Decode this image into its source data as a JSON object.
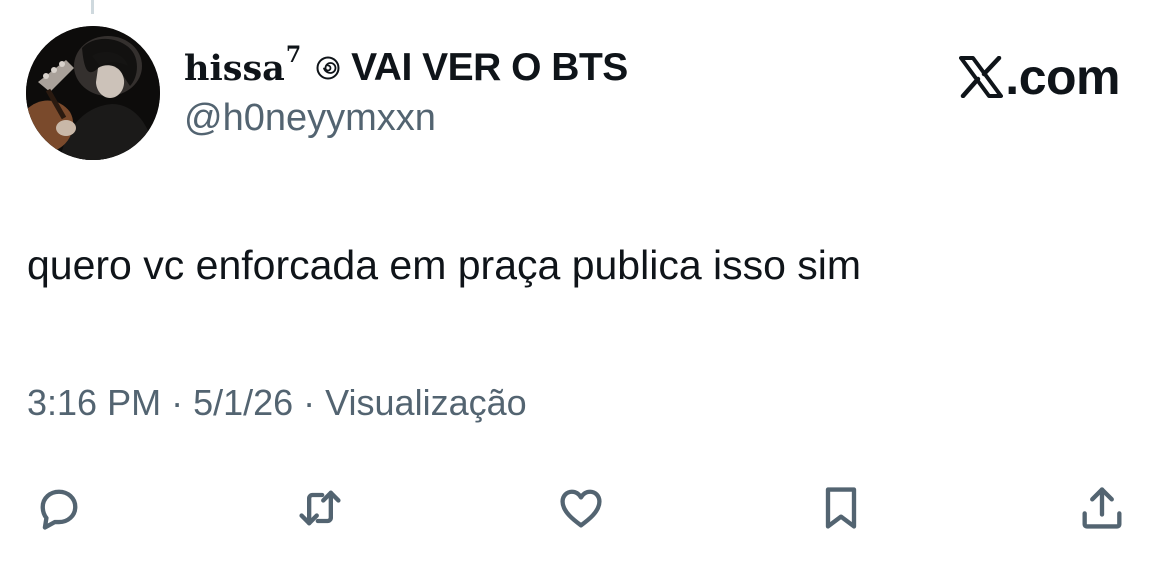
{
  "author": {
    "display_name_lower": "hissa",
    "display_name_sup": "7",
    "display_name_upper": "VAI VER O BTS",
    "handle": "@h0neyymxxn",
    "emoji_icon": "spiral-icon",
    "avatar": "profile-avatar"
  },
  "watermark": "X.com",
  "tweet": {
    "text": "quero vc enforcada em praça publica isso sim"
  },
  "meta": {
    "time": "3:16 PM",
    "sep1": " · ",
    "date": "5/1/26",
    "sep2": " · ",
    "views_label": "Visualização"
  },
  "actions": [
    {
      "name": "reply",
      "icon": "reply-icon"
    },
    {
      "name": "retweet",
      "icon": "retweet-icon"
    },
    {
      "name": "like",
      "icon": "heart-icon"
    },
    {
      "name": "bookmark",
      "icon": "bookmark-icon"
    },
    {
      "name": "share",
      "icon": "share-icon"
    }
  ],
  "colors": {
    "text_primary": "#0f1419",
    "text_secondary": "#536471",
    "thread_line": "#cfd9de"
  }
}
